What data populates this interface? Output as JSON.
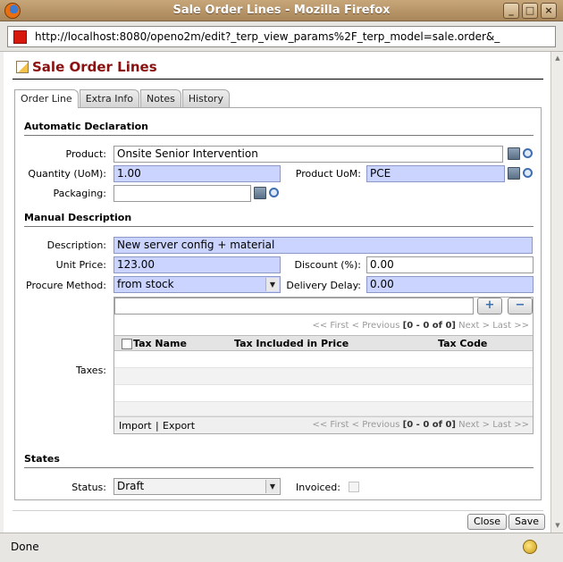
{
  "window": {
    "title": "Sale Order Lines - Mozilla Firefox"
  },
  "browser": {
    "url": "http://localhost:8080/openo2m/edit?_terp_view_params%2F_terp_model=sale.order&_",
    "status": "Done"
  },
  "page": {
    "title": "Sale Order Lines"
  },
  "tabs": [
    {
      "label": "Order Line"
    },
    {
      "label": "Extra Info"
    },
    {
      "label": "Notes"
    },
    {
      "label": "History"
    }
  ],
  "sections": {
    "automatic": "Automatic Declaration",
    "manual": "Manual Description",
    "states": "States"
  },
  "form": {
    "product": {
      "label": "Product:",
      "value": "Onsite Senior Intervention"
    },
    "quantity": {
      "label": "Quantity (UoM):",
      "value": "1.00"
    },
    "product_uom": {
      "label": "Product UoM:",
      "value": "PCE"
    },
    "packaging": {
      "label": "Packaging:",
      "value": ""
    },
    "description": {
      "label": "Description:",
      "value": "New server config + material"
    },
    "unit_price": {
      "label": "Unit Price:",
      "value": "123.00"
    },
    "discount": {
      "label": "Discount (%):",
      "value": "0.00"
    },
    "procure_method": {
      "label": "Procure Method:",
      "value": "from stock"
    },
    "delivery_delay": {
      "label": "Delivery Delay:",
      "value": "0.00"
    },
    "taxes": {
      "label": "Taxes:"
    },
    "status": {
      "label": "Status:",
      "value": "Draft"
    },
    "invoiced": {
      "label": "Invoiced:",
      "checked": false
    }
  },
  "taxes_grid": {
    "add_label": "+",
    "remove_label": "−",
    "pager": {
      "first": "<< First",
      "previous": "< Previous",
      "range": "[0 - 0 of 0]",
      "next": "Next >",
      "last": "Last >>"
    },
    "columns": [
      "Tax Name",
      "Tax Included in Price",
      "Tax Code"
    ],
    "import_label": "Import",
    "separator": "|",
    "export_label": "Export"
  },
  "buttons": {
    "close": "Close",
    "save": "Save"
  },
  "colors": {
    "required_field": "#cad4ff",
    "title": "#8b1111"
  }
}
